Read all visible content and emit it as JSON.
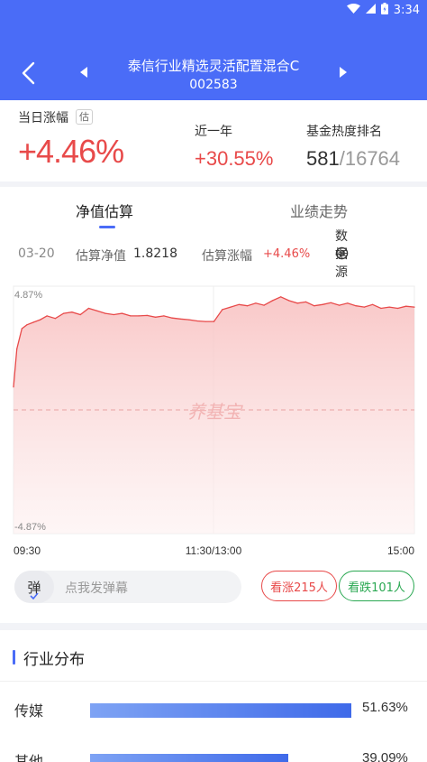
{
  "status_bar": {
    "time": "3:34"
  },
  "header": {
    "title": "泰信行业精选灵活配置混合C",
    "code": "002583"
  },
  "summary": {
    "daily_label": "当日涨幅",
    "est_tag": "估",
    "daily_value": "+4.46%",
    "year_label": "近一年",
    "year_value": "+30.55%",
    "rank_label": "基金热度排名",
    "rank_value": "581",
    "rank_sep": "/",
    "rank_total": "16764"
  },
  "tabs": [
    {
      "label": "净值估算",
      "active": true
    },
    {
      "label": "业绩走势",
      "active": false
    }
  ],
  "estimate": {
    "date": "03-20",
    "nav_label": "估算净值",
    "nav_value": "1.8218",
    "change_label": "估算涨幅",
    "change_value": "+4.46%",
    "source_label": "数据源"
  },
  "chart_data": {
    "type": "area",
    "y_top_label": "4.87%",
    "y_bottom_label": "-4.87%",
    "ylim": [
      -4.87,
      4.87
    ],
    "x_tick_labels": [
      "09:30",
      "11:30/13:00",
      "15:00"
    ],
    "watermark": "养基宝",
    "series": [
      {
        "x": [
          0,
          2,
          5,
          8,
          12,
          16,
          20,
          25,
          30,
          35,
          40,
          45,
          50,
          55,
          60,
          65,
          70,
          75,
          80,
          85,
          90,
          95,
          100,
          105,
          110,
          115,
          120,
          125,
          130,
          135,
          140,
          145,
          150,
          155,
          160,
          165,
          170,
          175,
          180,
          185,
          190,
          195,
          200,
          205,
          210,
          215,
          220,
          225,
          230,
          235,
          240
        ],
        "values": [
          0.9,
          2.4,
          3.2,
          3.35,
          3.45,
          3.55,
          3.7,
          3.6,
          3.8,
          3.85,
          3.75,
          4.0,
          3.9,
          3.8,
          3.75,
          3.8,
          3.7,
          3.7,
          3.72,
          3.65,
          3.7,
          3.62,
          3.58,
          3.55,
          3.5,
          3.48,
          3.48,
          3.95,
          4.05,
          4.15,
          4.1,
          4.2,
          4.12,
          4.3,
          4.45,
          4.3,
          4.2,
          4.25,
          4.1,
          4.15,
          4.22,
          4.12,
          4.2,
          4.1,
          4.05,
          4.15,
          4.0,
          4.05,
          4.0,
          4.08,
          4.05
        ]
      }
    ]
  },
  "danmu": {
    "button_label": "弹",
    "placeholder": "点我发弹幕",
    "up_label": "看涨215人",
    "down_label": "看跌101人"
  },
  "industry": {
    "title": "行业分布",
    "items": [
      {
        "name": "传媒",
        "percent": "51.63%",
        "value": 51.63
      },
      {
        "name": "其他",
        "percent": "39.09%",
        "value": 39.09
      }
    ]
  },
  "colors": {
    "brand": "#4a6cf7",
    "rise": "#e84a4a",
    "fall": "#2aa852"
  }
}
